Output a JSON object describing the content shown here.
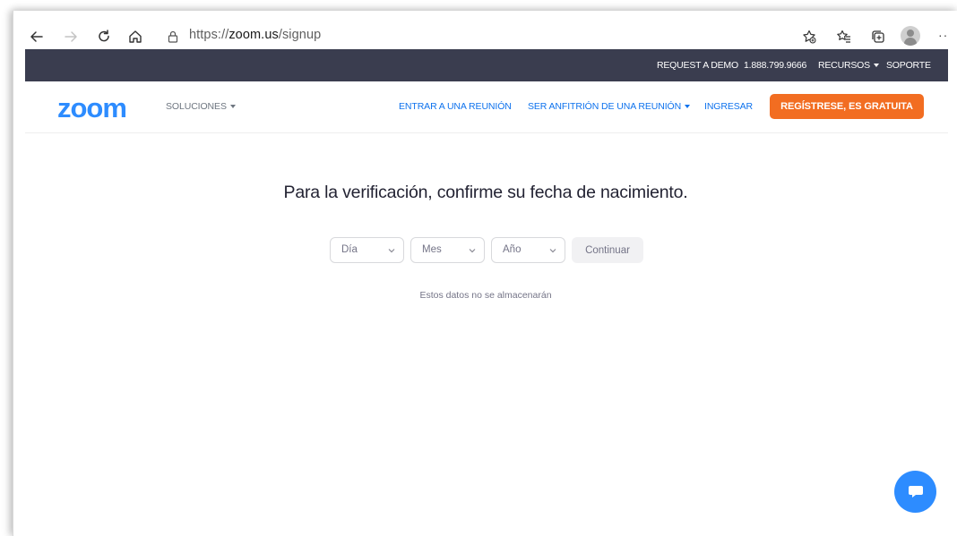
{
  "browser": {
    "url_scheme": "https://",
    "url_host": "zoom.us",
    "url_path": "/signup",
    "more_label": "··"
  },
  "topbar": {
    "request_demo": "REQUEST A DEMO",
    "phone": "1.888.799.9666",
    "resources": "RECURSOS",
    "support": "SOPORTE"
  },
  "nav": {
    "logo": "zoom",
    "solutions": "SOLUCIONES",
    "join": "ENTRAR A UNA REUNIÓN",
    "host": "SER ANFITRIÓN DE UNA REUNIÓN",
    "signin": "INGRESAR",
    "signup": "REGÍSTRESE, ES GRATUITA"
  },
  "main": {
    "heading": "Para la verificación, confirme su fecha de nacimiento.",
    "day_placeholder": "Día",
    "month_placeholder": "Mes",
    "year_placeholder": "Año",
    "continue": "Continuar",
    "note": "Estos datos no se almacenarán"
  },
  "colors": {
    "brand_blue": "#2d8cff",
    "link_blue": "#0e72ed",
    "topbar_bg": "#3a3d4f",
    "signup_orange": "#f26d21"
  },
  "icons": {
    "back": "arrow-left-icon",
    "forward": "arrow-right-icon",
    "refresh": "refresh-icon",
    "home": "home-icon",
    "lock": "lock-icon",
    "favorite_add": "star-add-icon",
    "favorites": "favorites-icon",
    "collections": "collections-icon",
    "profile": "avatar-icon",
    "chat": "chat-icon"
  }
}
